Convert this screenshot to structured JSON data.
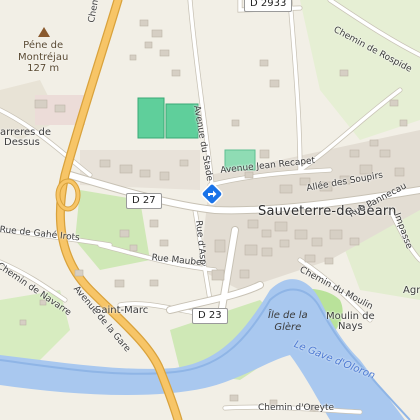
{
  "map": {
    "peak": {
      "name_line1": "Péne de",
      "name_line2": "Montréjau",
      "elevation": "127 m"
    },
    "places": {
      "town": "Sauveterre-de-Béarn",
      "saint_marc": "Saint-Marc",
      "carreres_line1": "arreres de",
      "carreres_line2": "Dessus",
      "moulin_line1": "Moulin de",
      "moulin_line2": "Nays",
      "agr": "Agr",
      "island_line1": "Île de la",
      "island_line2": "Glère"
    },
    "roads": {
      "chemin_left": "Chemin d",
      "avenue_du_stade": "Avenue du Stade",
      "chemin_rospide": "Chemin de Rospide",
      "avenue_jean_recapet": "Avenue Jean Recapet",
      "allee_des_soupirs": "Allée des Soupirs",
      "rue_pannecau": "Rue Pannecau",
      "impasse": "Impasse",
      "rue_gahe_irots": "Rue de Gahé Irots",
      "chemin_navarre": "Chemin de Navarre",
      "rue_maubec": "Rue Maubec",
      "rue_asp": "Rue d'Asp",
      "avenue_gare": "Avenue de la Gare",
      "chemin_moulin": "Chemin du Moulin",
      "chemin_oreyte": "Chemin d'Oreyte"
    },
    "shields": {
      "d27": "D 27",
      "d23": "D 23",
      "d2933": "D 2933"
    },
    "water": {
      "gave": "Le Gave d'Oloron"
    },
    "icons": {
      "poi": "diamond-direction-icon",
      "peak": "peak-triangle-icon"
    },
    "colors": {
      "background": "#f2efe6",
      "major_road": "#f7c567",
      "major_road_casing": "#d9a23c",
      "minor_road": "#ffffff",
      "river": "#a9c8ef",
      "grass": "#cde9b3",
      "sports_field": "#5fcf9b",
      "poi_blue": "#1a73e8"
    }
  }
}
